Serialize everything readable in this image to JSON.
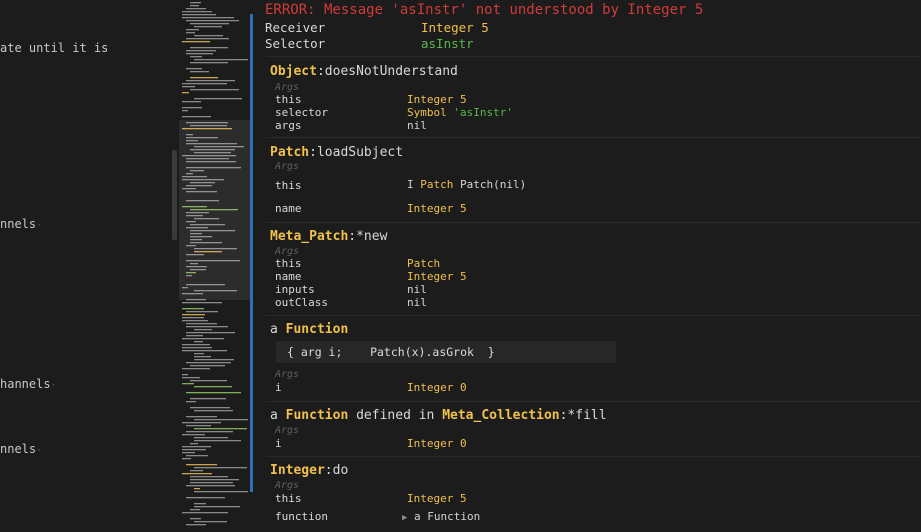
{
  "editor": {
    "fragments": [
      {
        "text": "ate until it is",
        "dotted": false
      },
      {
        "text": "nnels",
        "dotted": true
      },
      {
        "text": "hannels",
        "dotted": true
      },
      {
        "text": "nnels",
        "dotted": true
      }
    ]
  },
  "minimap": {},
  "debugger": {
    "error": "ERROR: Message 'asInstr' not understood by Integer 5",
    "receiver_label": "Receiver",
    "receiver_value": "Integer 5",
    "selector_label": "Selector",
    "selector_value": "asInstr",
    "args_label": "Args",
    "frames": {
      "f1": {
        "class": "Object",
        "method": ":doesNotUnderstand",
        "rows": [
          {
            "key": "this",
            "type": "Integer",
            "value": "5"
          },
          {
            "key": "selector",
            "type": "Symbol",
            "value": "'asInstr'"
          },
          {
            "key": "args",
            "type": "",
            "value": "nil"
          }
        ]
      },
      "f2": {
        "class": "Patch",
        "method": ":loadSubject",
        "this_key": "this",
        "this_type": "Patch",
        "this_value": "Patch(nil)",
        "name_key": "name",
        "name_type": "Integer",
        "name_value": "5"
      },
      "f3": {
        "class": "Meta_Patch",
        "method": ":*new",
        "rows": [
          {
            "key": "this",
            "type": "Patch",
            "value": ""
          },
          {
            "key": "name",
            "type": "Integer",
            "value": "5"
          },
          {
            "key": "inputs",
            "type": "",
            "value": "nil"
          },
          {
            "key": "outClass",
            "type": "",
            "value": "nil"
          }
        ]
      },
      "f4": {
        "prefix": "a ",
        "class": "Function",
        "code": "{ arg i;    Patch(x).asGrok  }",
        "row_key": "i",
        "row_type": "Integer",
        "row_value": "0"
      },
      "f5": {
        "prefix": "a ",
        "class": "Function",
        "middle": " defined in ",
        "class2": "Meta_Collection",
        "method": ":*fill",
        "row_key": "i",
        "row_type": "Integer",
        "row_value": "0"
      },
      "f6": {
        "class": "Integer",
        "method": ":do",
        "this_key": "this",
        "this_type": "Integer",
        "this_value": "5",
        "fn_key": "function",
        "fn_value": "a Function"
      }
    }
  },
  "colors": {
    "background": "#1c1c1c",
    "error": "#d23a3a",
    "class_name": "#f0c14b",
    "symbol_value": "#58b94a",
    "accent_bar": "#2f6fb5",
    "muted": "#5f5f5f"
  },
  "icons": {
    "expand": "triangle-right-icon",
    "text_cursor": "i-beam-cursor-icon"
  }
}
